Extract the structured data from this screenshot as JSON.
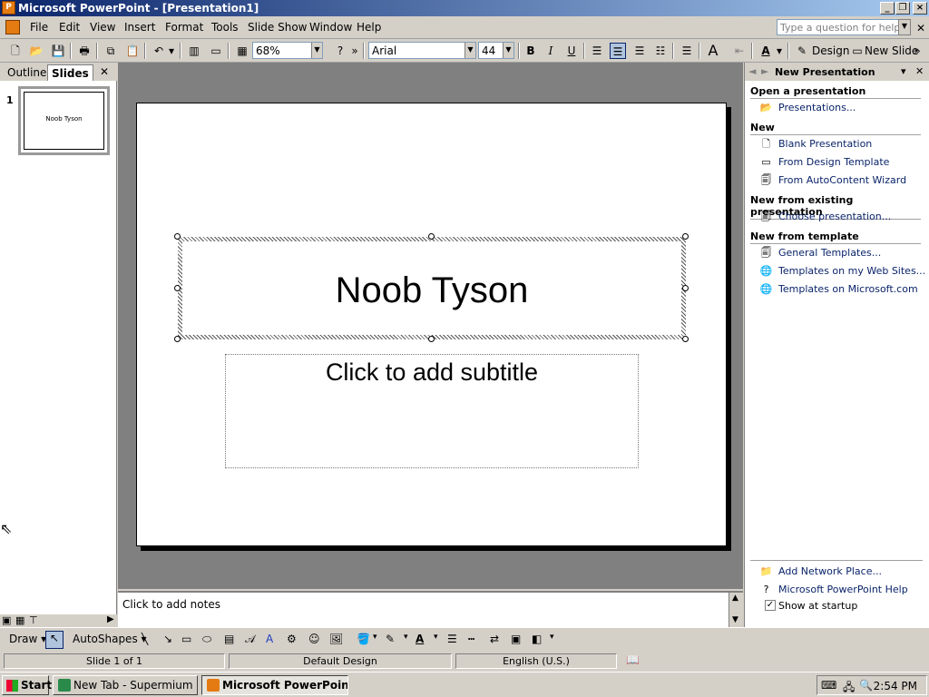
{
  "window": {
    "title": "Microsoft PowerPoint - [Presentation1]"
  },
  "menu": {
    "items": [
      "File",
      "Edit",
      "View",
      "Insert",
      "Format",
      "Tools",
      "Slide Show",
      "Window",
      "Help"
    ],
    "help_placeholder": "Type a question for help"
  },
  "toolbar": {
    "zoom": "68%",
    "font": "Arial",
    "font_size": "44",
    "design_label": "Design",
    "new_slide_label": "New Slide"
  },
  "left_pane": {
    "tab_outline": "Outline",
    "tab_slides": "Slides",
    "slide_number": "1",
    "thumb_title": "Noob Tyson"
  },
  "slide": {
    "title": "Noob Tyson",
    "subtitle_placeholder": "Click to add subtitle"
  },
  "notes": {
    "placeholder": "Click to add notes"
  },
  "task_pane": {
    "title": "New Presentation",
    "sections": {
      "open": {
        "title": "Open a presentation",
        "links": [
          "Presentations..."
        ]
      },
      "new": {
        "title": "New",
        "links": [
          "Blank Presentation",
          "From Design Template",
          "From AutoContent Wizard"
        ]
      },
      "existing": {
        "title": "New from existing presentation",
        "links": [
          "Choose presentation..."
        ]
      },
      "template": {
        "title": "New from template",
        "links": [
          "General Templates...",
          "Templates on my Web Sites...",
          "Templates on Microsoft.com"
        ]
      }
    },
    "bottom_links": [
      "Add Network Place...",
      "Microsoft PowerPoint Help"
    ],
    "show_at_startup": "Show at startup"
  },
  "draw_toolbar": {
    "draw_label": "Draw",
    "autoshapes_label": "AutoShapes"
  },
  "status": {
    "slide": "Slide 1 of 1",
    "design": "Default Design",
    "language": "English (U.S.)"
  },
  "taskbar": {
    "start": "Start",
    "tasks": [
      "New Tab - Supermium",
      "Microsoft PowerPoint ..."
    ],
    "clock": "2:54 PM"
  },
  "colors": {
    "title_bar_start": "#0a246a",
    "title_bar_end": "#a6caf0",
    "link": "#0a246a",
    "slide_area": "#808080"
  }
}
